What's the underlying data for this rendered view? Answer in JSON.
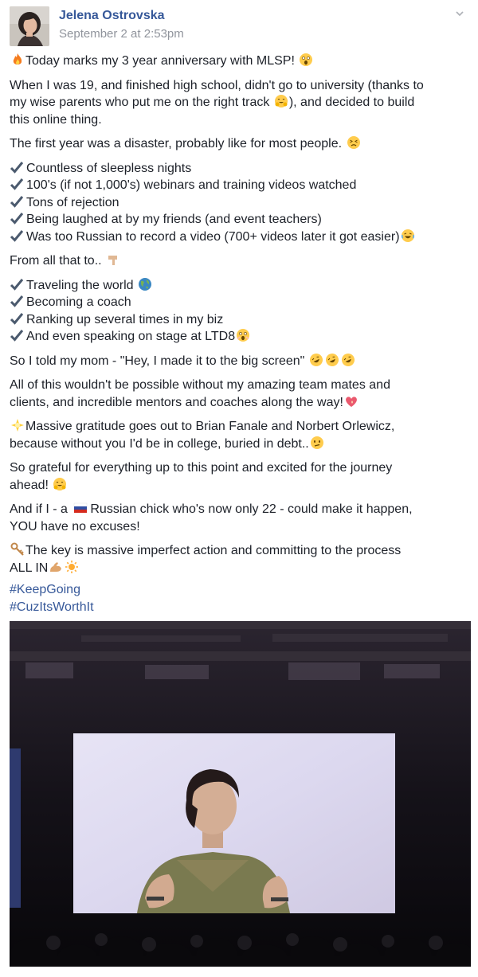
{
  "post": {
    "author": "Jelena Ostrovska",
    "timestamp": "September 2 at 2:53pm",
    "paragraphs": {
      "p1": "Today marks my 3 year anniversary with MLSP!",
      "p2a": "When I was 19, and finished high school, didn't go to university (thanks to",
      "p2b": "my wise parents who put me on the right track",
      "p2c": "), and decided to build",
      "p2d": "this online thing.",
      "p3": "The first year was a disaster, probably like for most people.",
      "list1": [
        "Countless of sleepless nights",
        "100's (if not 1,000's) webinars and training videos watched",
        "Tons of rejection",
        "Being laughed at by my friends (and event teachers)",
        "Was too Russian to record a video (700+ videos later it got easier)"
      ],
      "p4": "From all that to..",
      "list2": [
        "Traveling the world",
        "Becoming a coach",
        "Ranking up several times in my biz",
        "And even speaking on stage at LTD8"
      ],
      "p5": "So I told my mom - \"Hey, I made it to the big screen\"",
      "p6a": "All of this wouldn't be possible without my amazing team mates and",
      "p6b": "clients, and incredible mentors and coaches along the way!",
      "p7a": "Massive gratitude goes out to Brian Fanale and Norbert Orlewicz,",
      "p7b": "because without you I'd be in college, buried in debt..",
      "p8a": "So grateful for everything up to this point and excited for the journey",
      "p8b": "ahead!",
      "p9a_pre": "And if I - a ",
      "p9a_post": "Russian chick who's now only 22 - could make it happen,",
      "p9b": "YOU have no excuses!",
      "p10a": "The key is massive imperfect action and committing to the process",
      "p10b": "ALL IN"
    },
    "hashtags": [
      "#KeepGoing",
      "#CuzItsWorthIt"
    ]
  },
  "colors": {
    "link": "#365899",
    "text": "#1d2129",
    "meta": "#90949c"
  },
  "icons": {
    "fire": "fire-icon",
    "shocked": "screaming-face-icon",
    "blush": "grinning-hands-face-icon",
    "persevere": "persevering-face-icon",
    "check": "heavy-check-mark-icon",
    "laugh": "laughing-face-icon",
    "point": "pointing-down-icon",
    "globe": "globe-icon",
    "rofl": "rolling-laughing-icon",
    "heart": "sparkling-heart-icon",
    "sparkle": "glowing-star-icon",
    "confused": "confused-face-icon",
    "flag": "russia-flag-icon",
    "key": "key-icon",
    "muscle": "flexed-biceps-icon",
    "sun": "sun-icon"
  }
}
